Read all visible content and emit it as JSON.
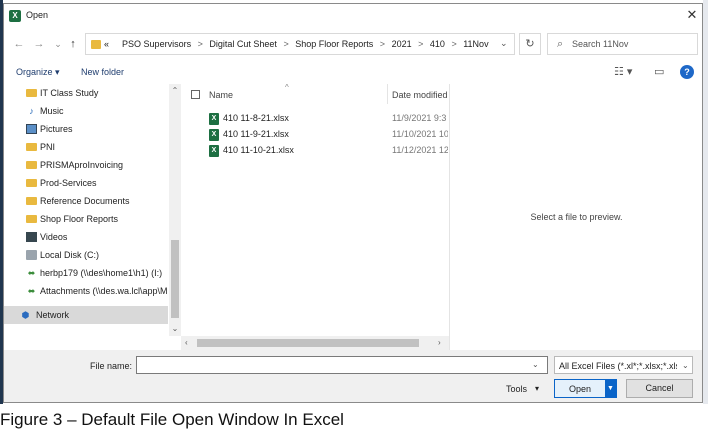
{
  "window": {
    "title": "Open",
    "app_icon": "excel-icon",
    "close_glyph": "✕"
  },
  "nav": {
    "back": "←",
    "forward": "→",
    "recent": "⌄",
    "up": "↑",
    "breadcrumb_prefix": "«",
    "breadcrumbs": [
      "PSO Supervisors",
      "Digital Cut Sheet",
      "Shop Floor Reports",
      "2021",
      "410",
      "11Nov"
    ],
    "separator": ">",
    "dropdown": "⌄",
    "refresh": "↻",
    "search_placeholder": "Search 11Nov"
  },
  "toolbar": {
    "organize": "Organize ▾",
    "new_folder": "New folder",
    "view_glyph": "☷ ▾",
    "pane_glyph": "▭",
    "help": "?"
  },
  "sidebar": {
    "items": [
      {
        "label": "IT Class Study",
        "icon": "folder-icon"
      },
      {
        "label": "Music",
        "icon": "music-icon"
      },
      {
        "label": "Pictures",
        "icon": "pictures-icon"
      },
      {
        "label": "PNI",
        "icon": "folder-icon"
      },
      {
        "label": "PRISMAproInvoicing",
        "icon": "folder-icon"
      },
      {
        "label": "Prod-Services",
        "icon": "folder-icon"
      },
      {
        "label": "Reference Documents",
        "icon": "folder-icon"
      },
      {
        "label": "Shop Floor Reports",
        "icon": "folder-icon"
      },
      {
        "label": "Videos",
        "icon": "videos-icon"
      },
      {
        "label": "Local Disk (C:)",
        "icon": "disk-icon"
      },
      {
        "label": "herbp179 (\\\\des\\home1\\h1) (I:)",
        "icon": "network-drive-icon"
      },
      {
        "label": "Attachments (\\\\des.wa.lcl\\app\\MPD)",
        "icon": "network-drive-icon"
      }
    ],
    "network": {
      "label": "Network",
      "icon": "network-icon"
    },
    "scroll_up": "⌃",
    "scroll_down": "⌄"
  },
  "file_list": {
    "columns": {
      "name": "Name",
      "date": "Date modified"
    },
    "sort_glyph": "^",
    "files": [
      {
        "name": "410 11-8-21.xlsx",
        "date": "11/9/2021 9:3"
      },
      {
        "name": "410 11-9-21.xlsx",
        "date": "11/10/2021 10"
      },
      {
        "name": "410 11-10-21.xlsx",
        "date": "11/12/2021 12"
      }
    ],
    "scroll_left": "‹",
    "scroll_right": "›"
  },
  "preview": {
    "text": "Select a file to preview."
  },
  "footer": {
    "filename_label": "File name:",
    "filename_value": "",
    "filename_dropdown": "⌄",
    "filter": "All Excel Files (*.xl*;*.xlsx;*.xlsm;",
    "filter_dropdown": "⌄",
    "tools": "Tools",
    "tools_dropdown": "▾",
    "open": "Open",
    "open_split": "▼",
    "cancel": "Cancel"
  },
  "caption": "Figure 3 – Default File Open Window In Excel"
}
